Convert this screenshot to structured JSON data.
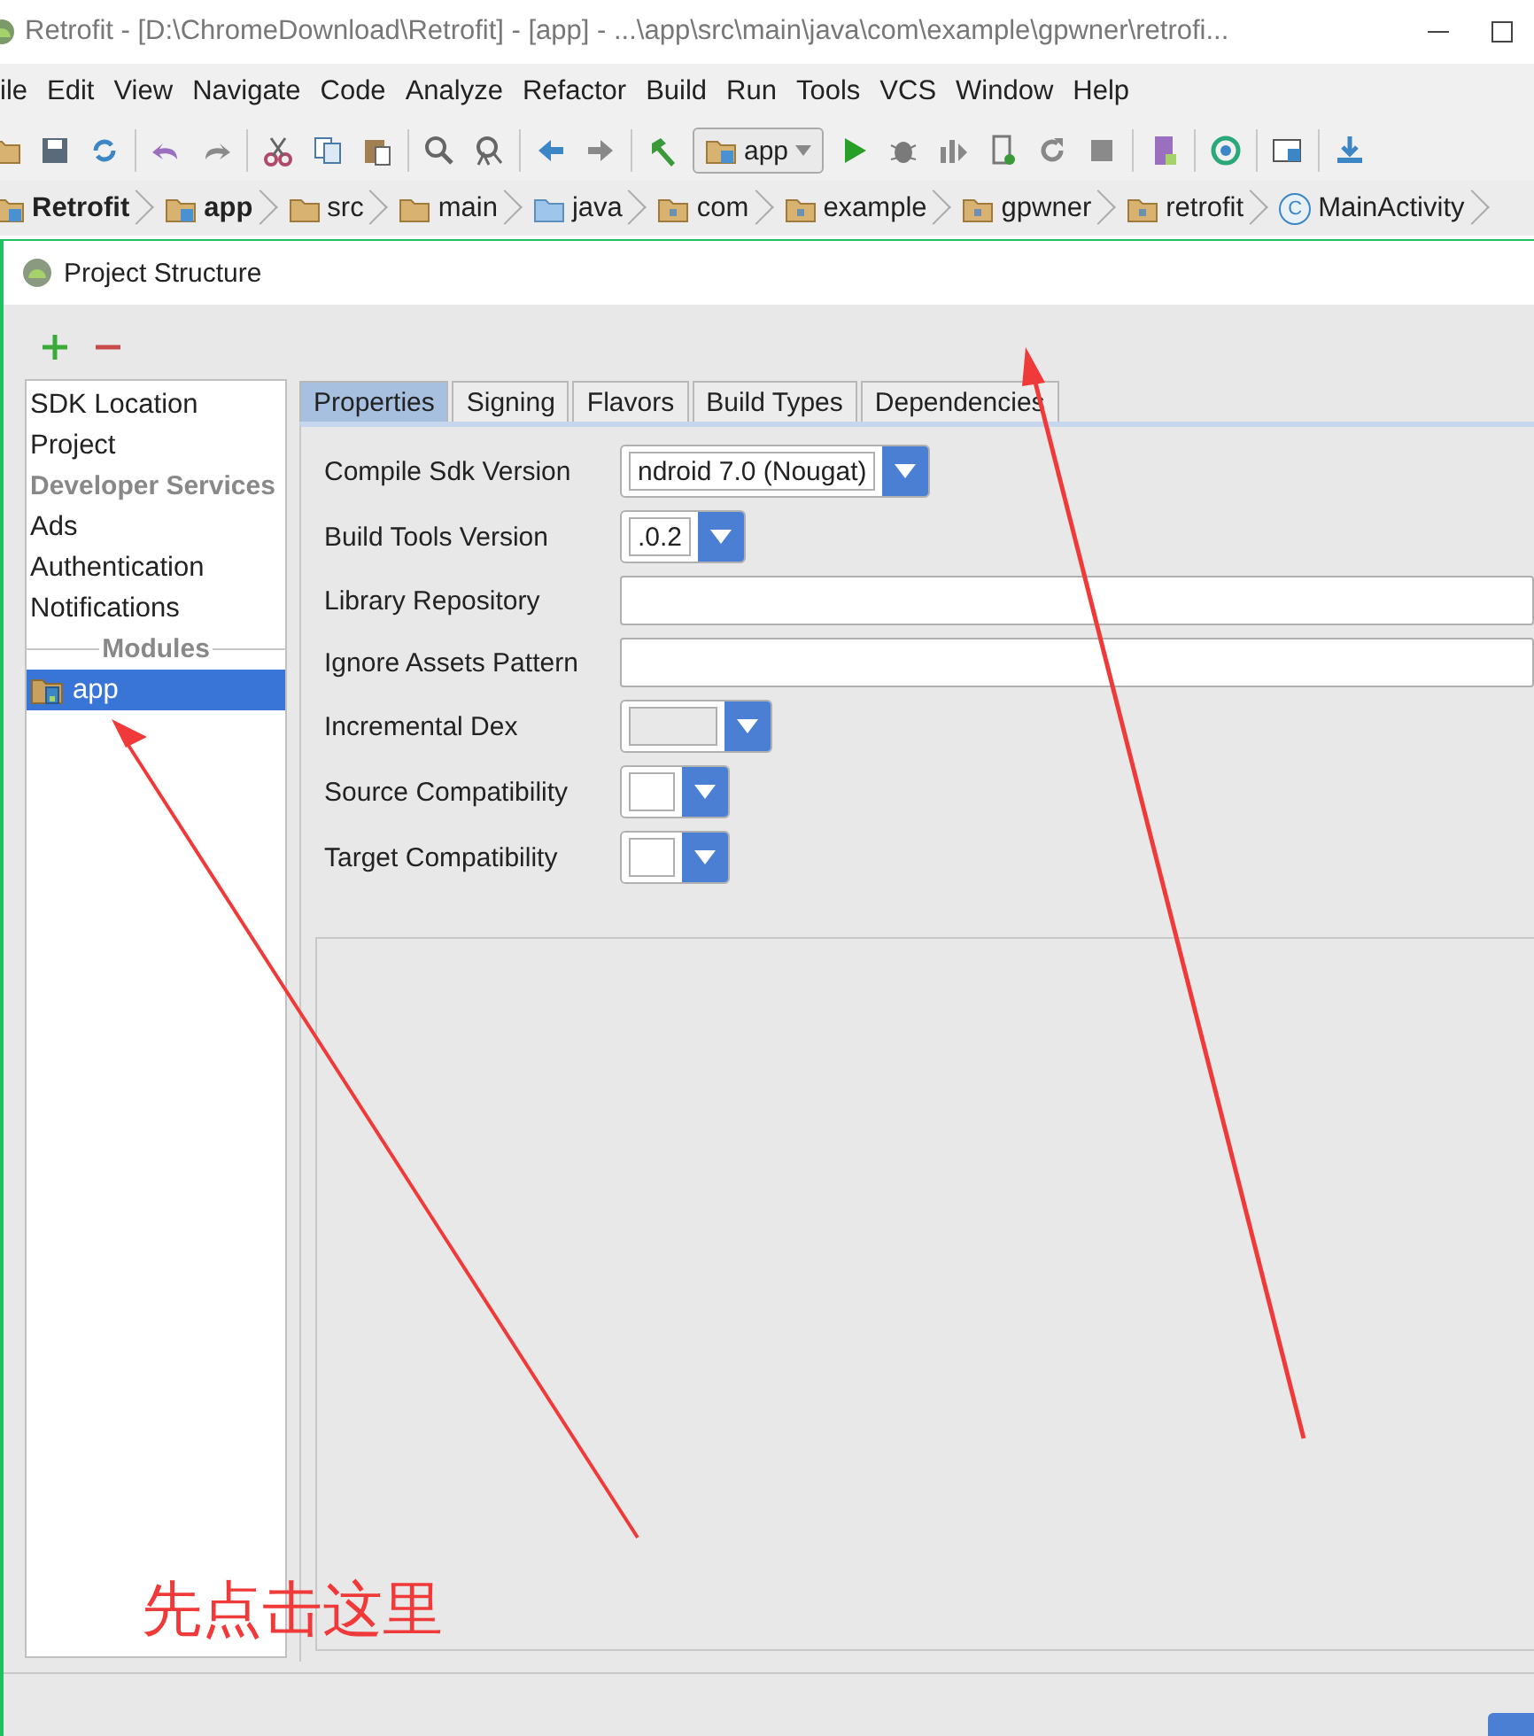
{
  "window": {
    "title": "Retrofit - [D:\\ChromeDownload\\Retrofit] - [app] - ...\\app\\src\\main\\java\\com\\example\\gpwner\\retrofi..."
  },
  "menu": [
    "ile",
    "Edit",
    "View",
    "Navigate",
    "Code",
    "Analyze",
    "Refactor",
    "Build",
    "Run",
    "Tools",
    "VCS",
    "Window",
    "Help"
  ],
  "toolbar": {
    "run_config": "app"
  },
  "breadcrumbs": [
    {
      "label": "Retrofit",
      "kind": "project"
    },
    {
      "label": "app",
      "kind": "module"
    },
    {
      "label": "src",
      "kind": "folder"
    },
    {
      "label": "main",
      "kind": "folder"
    },
    {
      "label": "java",
      "kind": "source"
    },
    {
      "label": "com",
      "kind": "package"
    },
    {
      "label": "example",
      "kind": "package"
    },
    {
      "label": "gpwner",
      "kind": "package"
    },
    {
      "label": "retrofit",
      "kind": "package"
    },
    {
      "label": "MainActivity",
      "kind": "class",
      "badge": "C"
    }
  ],
  "dialog": {
    "title": "Project Structure",
    "sidebar": [
      {
        "label": "SDK Location",
        "kind": "item",
        "selected": false
      },
      {
        "label": "Project",
        "kind": "item",
        "selected": false
      },
      {
        "label": "Developer Services",
        "kind": "header",
        "selected": false
      },
      {
        "label": "Ads",
        "kind": "item",
        "selected": false
      },
      {
        "label": "Authentication",
        "kind": "item",
        "selected": false
      },
      {
        "label": "Notifications",
        "kind": "item",
        "selected": false
      },
      {
        "label": "Modules",
        "kind": "divider",
        "selected": false
      },
      {
        "label": "app",
        "kind": "module",
        "selected": true
      }
    ],
    "tabs": [
      {
        "label": "Properties",
        "selected": true
      },
      {
        "label": "Signing",
        "selected": false
      },
      {
        "label": "Flavors",
        "selected": false
      },
      {
        "label": "Build Types",
        "selected": false
      },
      {
        "label": "Dependencies",
        "selected": false
      }
    ],
    "form": [
      {
        "label": "Compile Sdk Version",
        "kind": "dropdown",
        "value": "ndroid 7.0 (Nougat)",
        "disabled": false
      },
      {
        "label": "Build Tools Version",
        "kind": "dropdown",
        "value": ".0.2",
        "disabled": false
      },
      {
        "label": "Library Repository",
        "kind": "text"
      },
      {
        "label": "Ignore Assets Pattern",
        "kind": "text"
      },
      {
        "label": "Incremental Dex",
        "kind": "dropdown",
        "disabled": true
      },
      {
        "label": "Source Compatibility",
        "kind": "dropdown",
        "disabled": false
      },
      {
        "label": "Target Compatibility",
        "kind": "dropdown",
        "disabled": false
      }
    ]
  },
  "annotation": {
    "text": "先点击这里"
  }
}
